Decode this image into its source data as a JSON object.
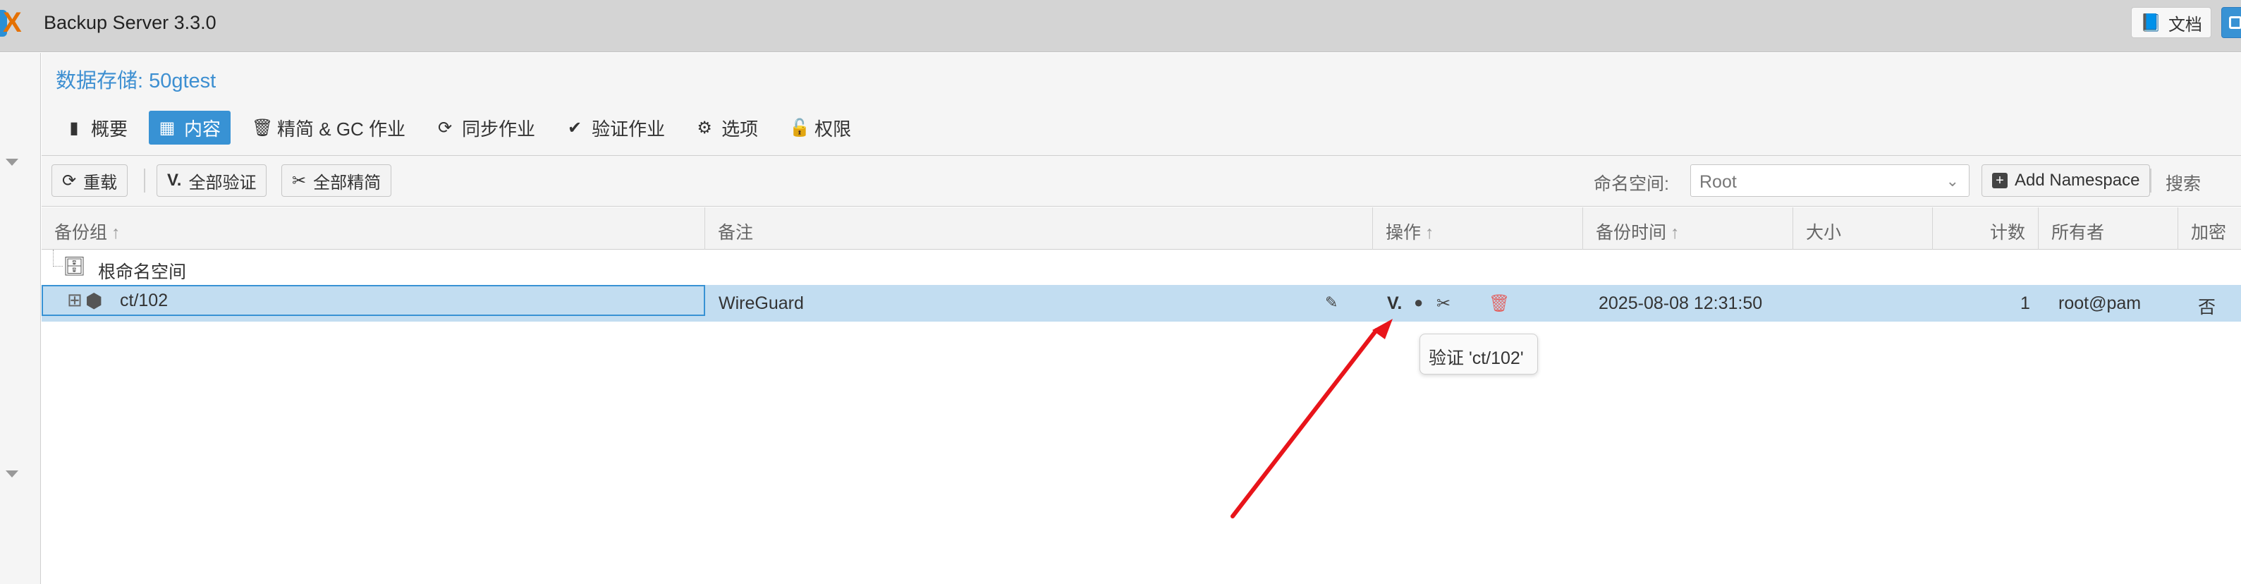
{
  "header": {
    "app_title": "Backup Server 3.3.0",
    "logo_text": "X",
    "docs_label": "文档"
  },
  "panel": {
    "title": "数据存储: 50gtest",
    "tabs": [
      {
        "label": "概要",
        "icon": "book-icon"
      },
      {
        "label": "内容",
        "icon": "grid-icon",
        "active": true
      },
      {
        "label": "精简 & GC 作业",
        "icon": "trash-icon"
      },
      {
        "label": "同步作业",
        "icon": "refresh-icon"
      },
      {
        "label": "验证作业",
        "icon": "check-circle-icon"
      },
      {
        "label": "选项",
        "icon": "gear-icon"
      },
      {
        "label": "权限",
        "icon": "unlock-icon"
      }
    ]
  },
  "toolbar": {
    "reload_label": "重载",
    "verify_all_label": "全部验证",
    "prune_all_label": "全部精简",
    "namespace_label": "命名空间:",
    "namespace_value": "Root",
    "add_namespace_label": "Add Namespace",
    "search_label": "搜索"
  },
  "grid": {
    "columns": [
      "备份组",
      "备注",
      "操作",
      "备份时间",
      "大小",
      "计数",
      "所有者",
      "加密"
    ],
    "root_label": "根命名空间",
    "rows": [
      {
        "group": "ct/102",
        "comment": "WireGuard",
        "action_verify": "V.",
        "backup_time": "2025-08-08 12:31:50",
        "size": "",
        "count": "1",
        "owner": "root@pam",
        "encrypted": "否"
      }
    ]
  },
  "tooltip": "验证 'ct/102'",
  "colors": {
    "accent": "#3892d4",
    "selected_row": "#c2ddf1",
    "annotation_arrow": "#e8141a",
    "delete": "#e06666"
  }
}
